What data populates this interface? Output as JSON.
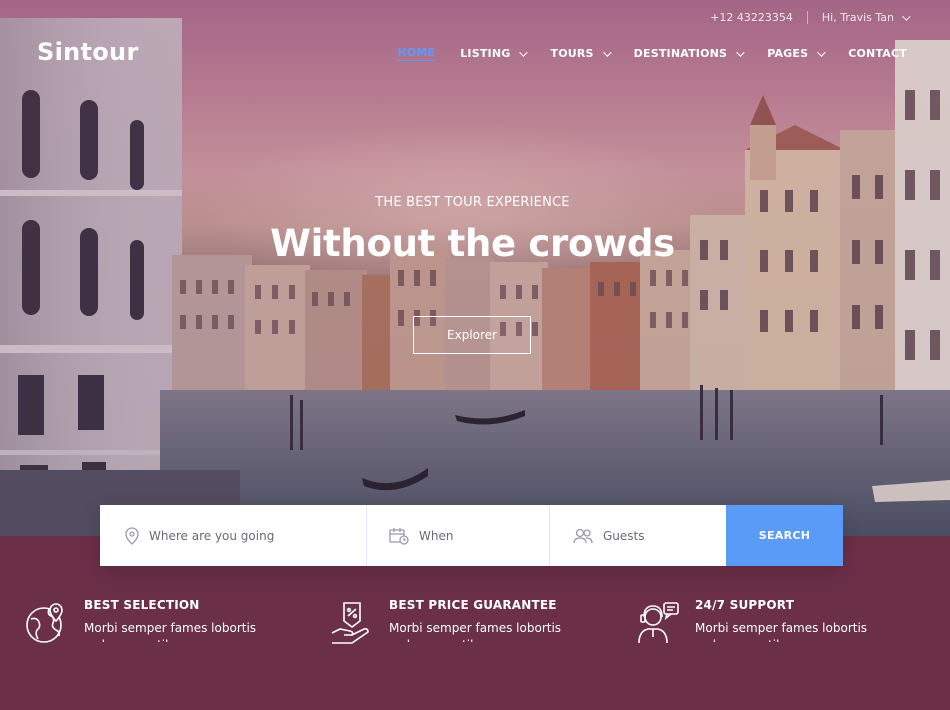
{
  "topbar": {
    "phone": "+12 43223354",
    "greeting": "Hi, Travis Tan"
  },
  "brand": {
    "logo": "Sintour"
  },
  "nav": {
    "items": [
      {
        "label": "HOME",
        "active": true,
        "has_dropdown": false
      },
      {
        "label": "LISTING",
        "has_dropdown": true
      },
      {
        "label": "TOURS",
        "has_dropdown": true
      },
      {
        "label": "DESTINATIONS",
        "has_dropdown": true
      },
      {
        "label": "PAGES",
        "has_dropdown": true
      },
      {
        "label": "CONTACT",
        "has_dropdown": false
      }
    ]
  },
  "hero": {
    "eyebrow": "THE BEST TOUR EXPERIENCE",
    "headline": "Without the crowds",
    "cta": "Explorer"
  },
  "search": {
    "where_placeholder": "Where are you going",
    "when_placeholder": "When",
    "guests_placeholder": "Guests",
    "button": "SEARCH",
    "where_icon": "map-pin-icon",
    "when_icon": "calendar-icon",
    "guests_icon": "users-icon"
  },
  "features": [
    {
      "title": "BEST SELECTION",
      "text": "Morbi semper fames lobortis ac hac penatibus",
      "icon": "globe-pin-icon"
    },
    {
      "title": "BEST PRICE GUARANTEE",
      "text": "Morbi semper fames lobortis ac hac penatibus",
      "icon": "price-hand-icon"
    },
    {
      "title": "24/7 SUPPORT",
      "text": "Morbi semper fames lobortis ac hac penatibus",
      "icon": "support-agent-icon"
    }
  ],
  "colors": {
    "accent": "#5a9bf8",
    "nav_active": "#5b9bff",
    "features_bg": "#6b2f48"
  }
}
